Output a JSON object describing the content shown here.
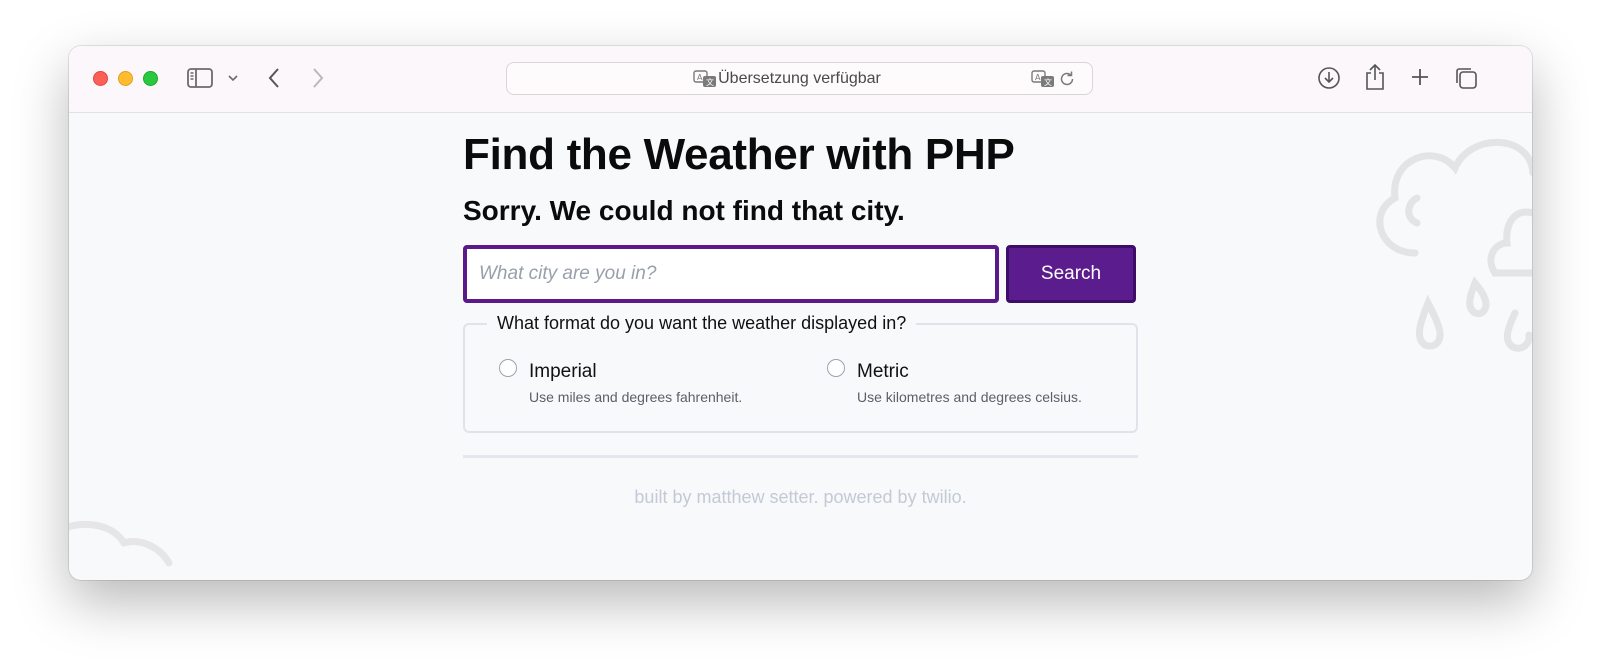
{
  "browser": {
    "address_bar_text": "Übersetzung verfügbar",
    "icons": {
      "sidebar": "sidebar-icon",
      "chevron": "chevron-down-icon",
      "back": "back-arrow-icon",
      "forward": "forward-arrow-icon",
      "translate": "translate-icon",
      "reload": "reload-icon",
      "download": "download-icon",
      "share": "share-icon",
      "new_tab": "plus-icon",
      "tabs": "tab-overview-icon"
    }
  },
  "page": {
    "title": "Find the Weather with PHP",
    "error_message": "Sorry. We could not find that city.",
    "search": {
      "placeholder": "What city are you in?",
      "value": "",
      "button_label": "Search"
    },
    "format": {
      "legend": "What format do you want the weather displayed in?",
      "options": [
        {
          "label": "Imperial",
          "hint": "Use miles and degrees fahrenheit.",
          "selected": false
        },
        {
          "label": "Metric",
          "hint": "Use kilometres and degrees celsius.",
          "selected": false
        }
      ]
    },
    "footer": "built by matthew setter. powered by twilio."
  },
  "colors": {
    "accent": "#5b1d8e",
    "accent_border": "#3d0d68",
    "page_background": "#f8f9fb",
    "footer_text": "#c3cad6"
  }
}
